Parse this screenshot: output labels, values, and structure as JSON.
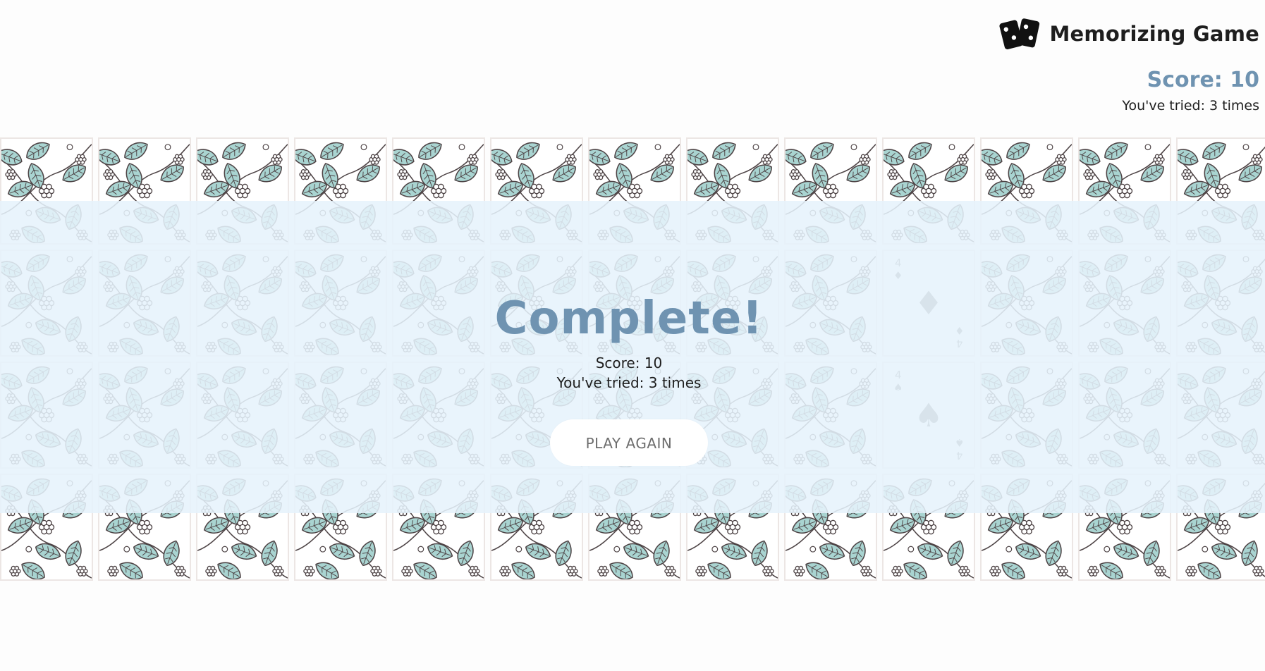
{
  "header": {
    "title": "Memorizing Game",
    "logo_icon": "playing-cards-icon"
  },
  "scoreboard": {
    "score": "Score: 10",
    "tries": "You've tried: 3 times"
  },
  "board": {
    "columns": 13,
    "rows": 4,
    "face_up_cards": [
      {
        "row": 1,
        "col": 9,
        "rank": "4",
        "suit": "♦",
        "suit_name": "diamonds"
      },
      {
        "row": 2,
        "col": 9,
        "rank": "4",
        "suit": "♠",
        "suit_name": "spades"
      }
    ],
    "card_back_colors": {
      "leaf": "#a9d4d1",
      "line": "#4e4446",
      "background": "#ffffff"
    }
  },
  "overlay": {
    "title": "Complete!",
    "score": "Score: 10",
    "tries": "You've tried: 3 times",
    "play_again_label": "PLAY AGAIN"
  },
  "colors": {
    "accent": "#6f93b1",
    "overlay": "#e6f2fc",
    "text": "#1e1e1e"
  }
}
